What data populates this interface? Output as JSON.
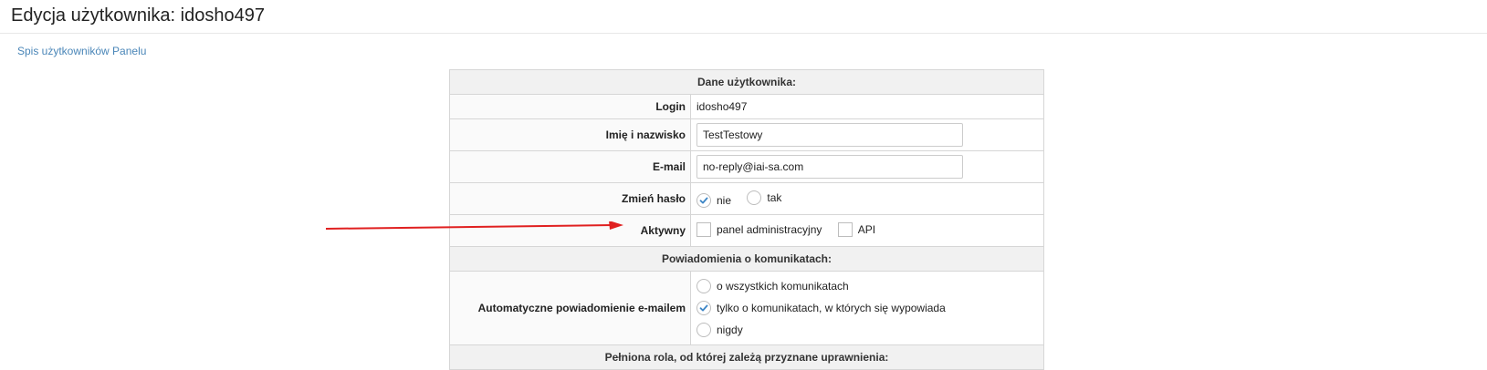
{
  "page": {
    "title": "Edycja użytkownika: idosho497",
    "back_link": "Spis użytkowników Panelu"
  },
  "form": {
    "section_user": "Dane użytkownika:",
    "login_label": "Login",
    "login_value": "idosho497",
    "name_label": "Imię i nazwisko",
    "name_value": "TestTestowy",
    "email_label": "E-mail",
    "email_value": "no-reply@iai-sa.com",
    "password_label": "Zmień hasło",
    "password_options": [
      {
        "label": "nie",
        "checked": true
      },
      {
        "label": "tak",
        "checked": false
      }
    ],
    "active_label": "Aktywny",
    "active_options": [
      {
        "label": "panel administracyjny",
        "checked": false
      },
      {
        "label": "API",
        "checked": false
      }
    ],
    "section_notifications": "Powiadomienia o komunikatach:",
    "auto_notify_label": "Automatyczne powiadomienie e-mailem",
    "auto_notify_options": [
      {
        "label": "o wszystkich komunikatach",
        "checked": false
      },
      {
        "label": "tylko o komunikatach, w których się wypowiada",
        "checked": true
      },
      {
        "label": "nigdy",
        "checked": false
      }
    ],
    "section_role": "Pełniona rola, od której zależą przyznane uprawnienia:"
  },
  "colors": {
    "accent": "#3d86c6",
    "link": "#4a86b8",
    "annotation_arrow": "#e02020",
    "section_bg": "#f1f1f1",
    "border": "#d6d6d6"
  }
}
